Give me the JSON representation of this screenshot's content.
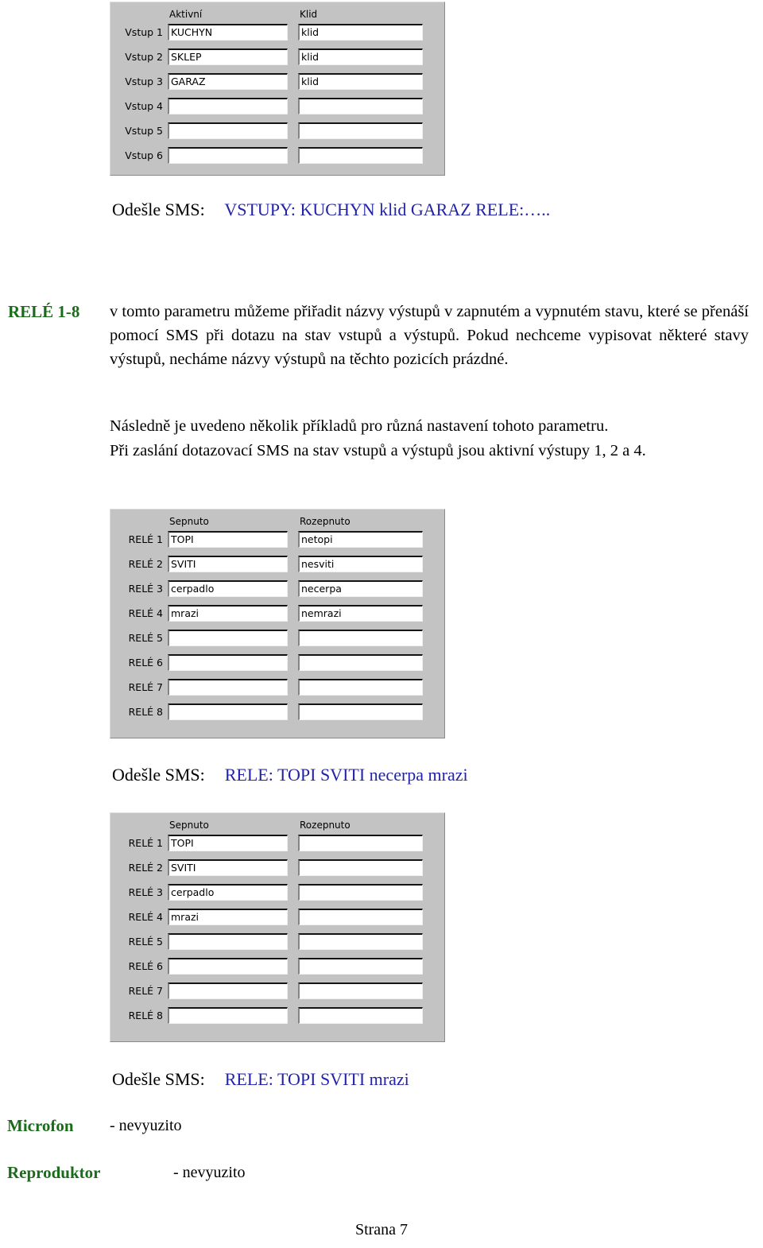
{
  "document": {
    "footer_page": "Strana 7"
  },
  "panel_inputs": {
    "col_headers": [
      "Aktivní",
      "Klid"
    ],
    "rows": [
      {
        "label": "Vstup 1",
        "active": "KUCHYN",
        "idle": "klid"
      },
      {
        "label": "Vstup 2",
        "active": "SKLEP",
        "idle": "klid"
      },
      {
        "label": "Vstup 3",
        "active": "GARAZ",
        "idle": "klid"
      },
      {
        "label": "Vstup 4",
        "active": "",
        "idle": ""
      },
      {
        "label": "Vstup 5",
        "active": "",
        "idle": ""
      },
      {
        "label": "Vstup 6",
        "active": "",
        "idle": ""
      }
    ]
  },
  "sms_inputs": {
    "lead": "Odešle SMS:",
    "message": "VSTUPY: KUCHYN  klid GARAZ  RELE:….."
  },
  "param_rele": {
    "key": "RELÉ 1-8",
    "text": "v tomto parametru můžeme přiřadit názvy výstupů v zapnutém a vypnutém stavu, které se přenáší pomocí SMS při dotazu na stav vstupů a výstupů. Pokud nechceme vypisovat některé stavy výstupů, necháme názvy výstupů na těchto pozicích prázdné."
  },
  "paragraph_examples": {
    "line1": "Následně je uvedeno několik příkladů pro různá nastavení tohoto parametru.",
    "line2": "Při zaslání dotazovací SMS na stav vstupů a výstupů jsou aktivní výstupy 1, 2 a 4."
  },
  "panel_relay_full": {
    "col_headers": [
      "Sepnuto",
      "Rozepnuto"
    ],
    "rows": [
      {
        "label": "RELÉ 1",
        "on": "TOPI",
        "off": "netopi"
      },
      {
        "label": "RELÉ 2",
        "on": "SVITI",
        "off": "nesviti"
      },
      {
        "label": "RELÉ 3",
        "on": "cerpadlo",
        "off": "necerpa"
      },
      {
        "label": "RELÉ 4",
        "on": "mrazi",
        "off": "nemrazi"
      },
      {
        "label": "RELÉ 5",
        "on": "",
        "off": ""
      },
      {
        "label": "RELÉ 6",
        "on": "",
        "off": ""
      },
      {
        "label": "RELÉ 7",
        "on": "",
        "off": ""
      },
      {
        "label": "RELÉ 8",
        "on": "",
        "off": ""
      }
    ]
  },
  "sms_relay_full": {
    "lead": "Odešle SMS:",
    "message": "RELE: TOPI  SVITI  necerpa  mrazi"
  },
  "panel_relay_on_only": {
    "col_headers": [
      "Sepnuto",
      "Rozepnuto"
    ],
    "rows": [
      {
        "label": "RELÉ 1",
        "on": "TOPI",
        "off": ""
      },
      {
        "label": "RELÉ 2",
        "on": "SVITI",
        "off": ""
      },
      {
        "label": "RELÉ 3",
        "on": "cerpadlo",
        "off": ""
      },
      {
        "label": "RELÉ 4",
        "on": "mrazi",
        "off": ""
      },
      {
        "label": "RELÉ 5",
        "on": "",
        "off": ""
      },
      {
        "label": "RELÉ 6",
        "on": "",
        "off": ""
      },
      {
        "label": "RELÉ 7",
        "on": "",
        "off": ""
      },
      {
        "label": "RELÉ 8",
        "on": "",
        "off": ""
      }
    ]
  },
  "sms_relay_on_only": {
    "lead": "Odešle SMS:",
    "message": "RELE: TOPI  SVITI   mrazi"
  },
  "param_microfon": {
    "key": "Microfon",
    "value": "- nevyuzito"
  },
  "param_reproduktor": {
    "key": "Reproduktor",
    "value": "- nevyuzito"
  },
  "colors": {
    "param_key_green": "#1a6b1a",
    "sms_blue": "#2222aa",
    "panel_gray": "#c3c3c3"
  }
}
